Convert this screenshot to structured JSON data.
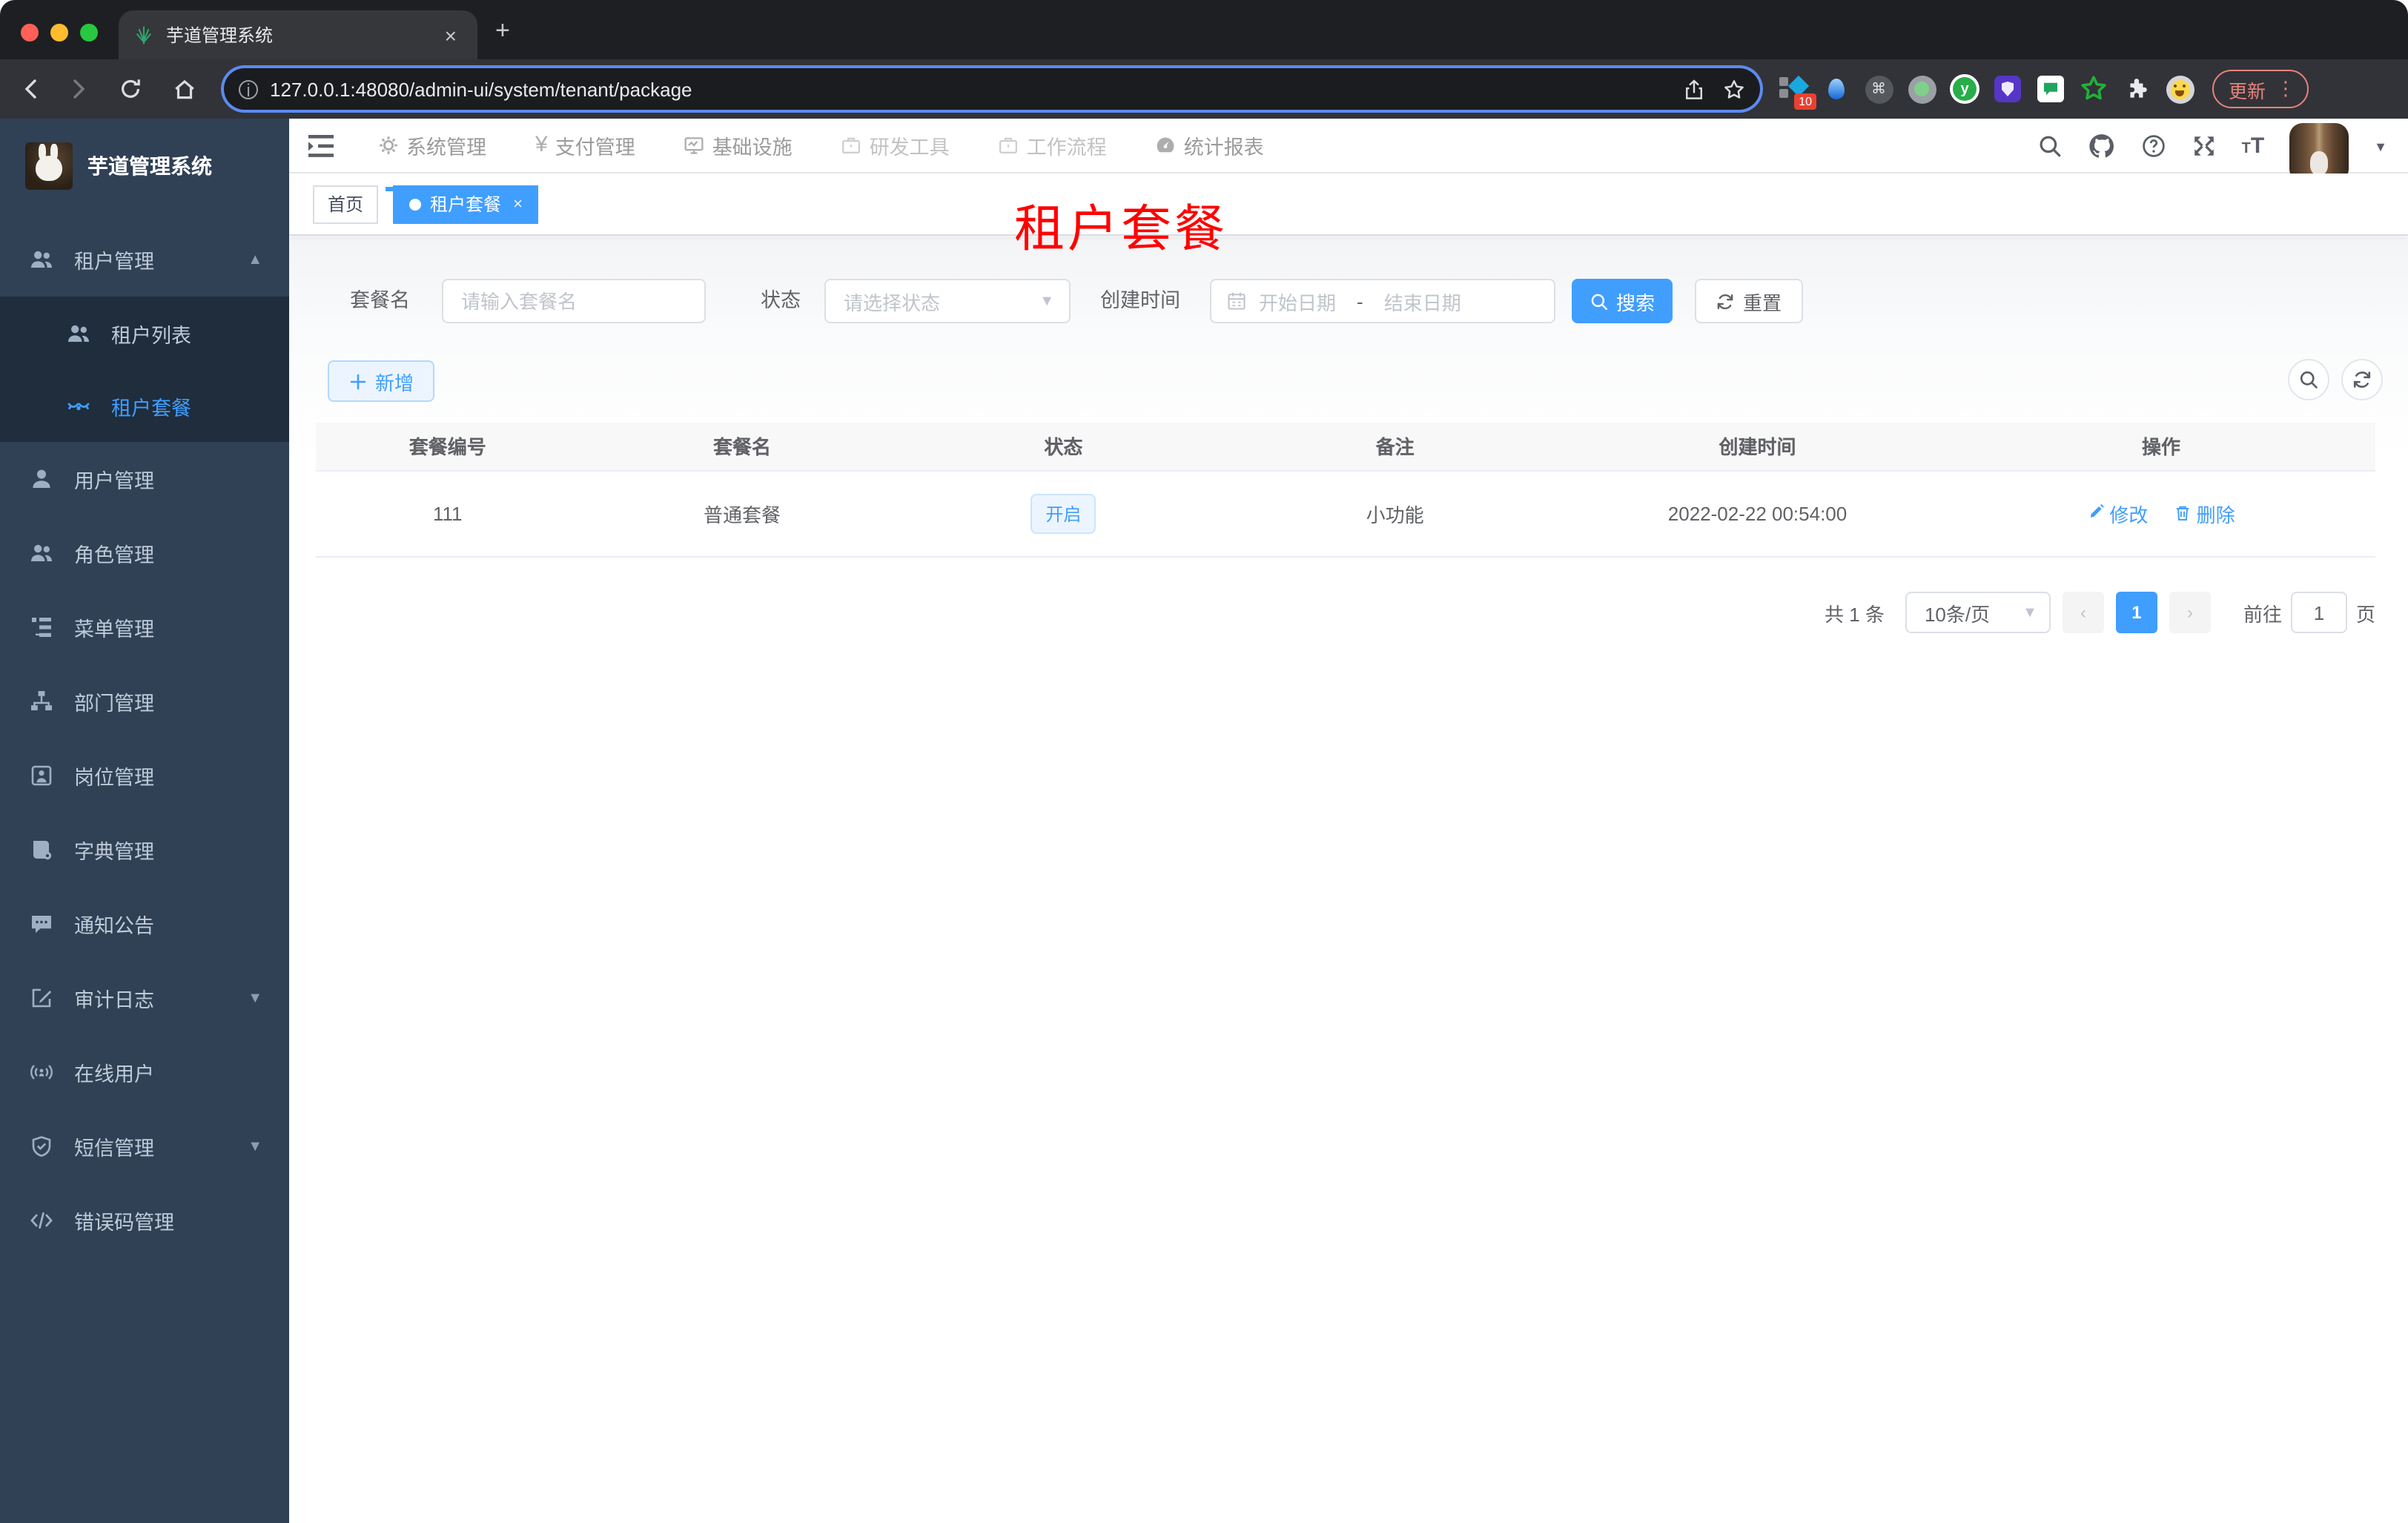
{
  "colors": {
    "primary": "#409eff",
    "sidebar_bg": "#304156",
    "submenu_bg": "#1f2d3d",
    "red_title": "#ff0000",
    "update_pill": "#e8837b",
    "traffic_red": "#ff5f57",
    "traffic_yellow": "#febc2e",
    "traffic_green": "#28c840"
  },
  "browser": {
    "tab_title": "芋道管理系统",
    "tab_close": "×",
    "new_tab": "+",
    "url": "127.0.0.1:48080/admin-ui/system/tenant/package",
    "info_glyph": "ⓘ",
    "extensions_badge": "10",
    "cmd_glyph": "⌘",
    "y_ext_glyph": "y",
    "update_label": "更新",
    "menu_dots": "⋮"
  },
  "sidebar": {
    "logo_title": "芋道管理系统",
    "menu": [
      {
        "label": "租户管理",
        "icon": "users-icon",
        "expanded": true
      },
      {
        "label": "租户列表",
        "icon": "peoples-icon"
      },
      {
        "label": "租户套餐",
        "icon": "package-icon",
        "active": true
      },
      {
        "label": "用户管理",
        "icon": "user-icon"
      },
      {
        "label": "角色管理",
        "icon": "role-icon"
      },
      {
        "label": "菜单管理",
        "icon": "menu-tree-icon"
      },
      {
        "label": "部门管理",
        "icon": "org-icon"
      },
      {
        "label": "岗位管理",
        "icon": "post-icon"
      },
      {
        "label": "字典管理",
        "icon": "dict-icon"
      },
      {
        "label": "通知公告",
        "icon": "notice-icon"
      },
      {
        "label": "审计日志",
        "icon": "log-icon",
        "arrow": "down"
      },
      {
        "label": "在线用户",
        "icon": "online-icon"
      },
      {
        "label": "短信管理",
        "icon": "sms-icon",
        "arrow": "down"
      },
      {
        "label": "错误码管理",
        "icon": "code-icon"
      }
    ]
  },
  "navbar": {
    "menu": [
      {
        "label": "系统管理",
        "active": true
      },
      {
        "label": "支付管理",
        "yen": "¥"
      },
      {
        "label": "基础设施"
      },
      {
        "label": "研发工具"
      },
      {
        "label": "工作流程"
      },
      {
        "label": "统计报表"
      }
    ]
  },
  "tags": {
    "home": "首页",
    "active": "租户套餐",
    "close": "×"
  },
  "page_title": "租户套餐",
  "filter": {
    "name_label": "套餐名",
    "name_placeholder": "请输入套餐名",
    "status_label": "状态",
    "status_placeholder": "请选择状态",
    "date_label": "创建时间",
    "date_start": "开始日期",
    "date_sep": "-",
    "date_end": "结束日期",
    "search_label": "搜索",
    "reset_label": "重置"
  },
  "toolbar": {
    "add_label": "新增"
  },
  "table": {
    "columns": [
      "套餐编号",
      "套餐名",
      "状态",
      "备注",
      "创建时间",
      "操作"
    ],
    "rows": [
      {
        "id": "111",
        "name": "普通套餐",
        "status": "开启",
        "remark": "小功能",
        "created": "2022-02-22 00:54:00",
        "edit_label": "修改",
        "delete_label": "删除"
      }
    ]
  },
  "pagination": {
    "total_text": "共 1 条",
    "page_size": "10条/页",
    "prev": "‹",
    "current": "1",
    "next": "›",
    "goto_label": "前往",
    "goto_value": "1",
    "page_unit": "页"
  }
}
